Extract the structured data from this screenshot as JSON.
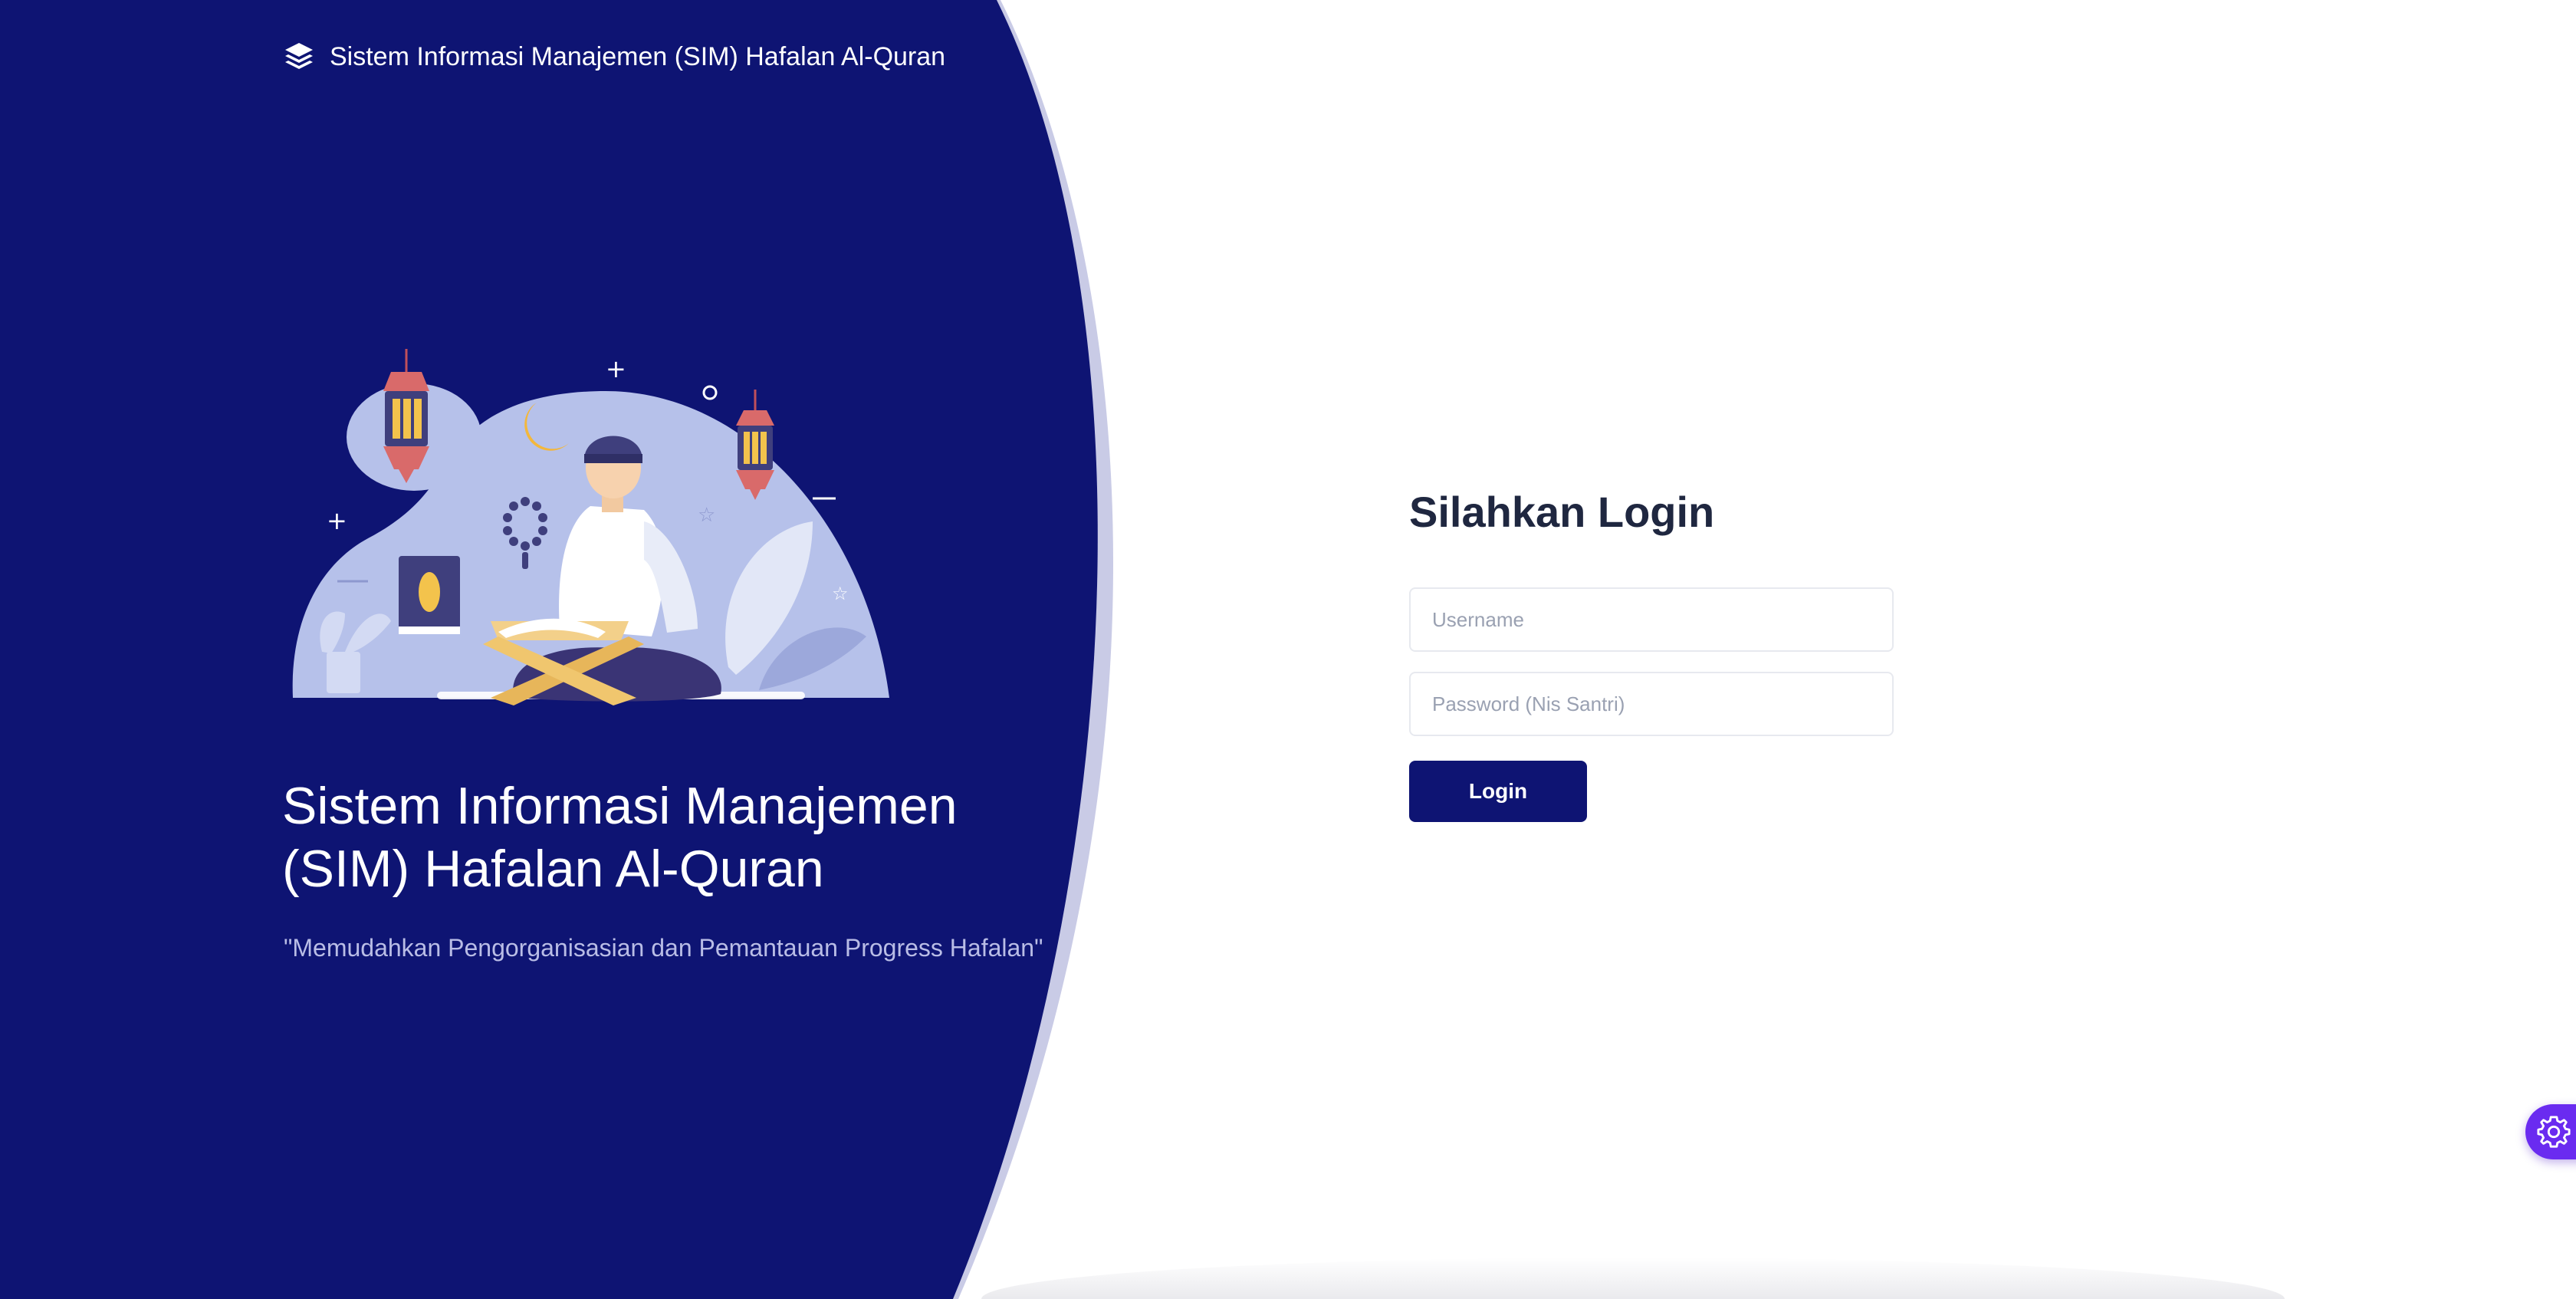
{
  "brand": {
    "title": "Sistem Informasi Manajemen (SIM) Hafalan Al-Quran",
    "icon": "layers-icon"
  },
  "hero": {
    "title": "Sistem Informasi Manajemen (SIM) Hafalan Al-Quran",
    "tagline": "\"Memudahkan Pengorganisasian dan Pemantauan Progress Hafalan\""
  },
  "login": {
    "heading": "Silahkan Login",
    "username_placeholder": "Username",
    "username_value": "",
    "password_placeholder": "Password (Nis Santri)",
    "password_value": "",
    "submit_label": "Login"
  },
  "settings": {
    "icon": "gear-icon"
  },
  "colors": {
    "hero_background": "#0e1473",
    "hero_accent_band": "#c9cbe6",
    "primary_button": "#0e1473",
    "settings_button": "#6a2bf0",
    "tagline_text": "#b9bde6",
    "heading_text": "#1f2740"
  }
}
